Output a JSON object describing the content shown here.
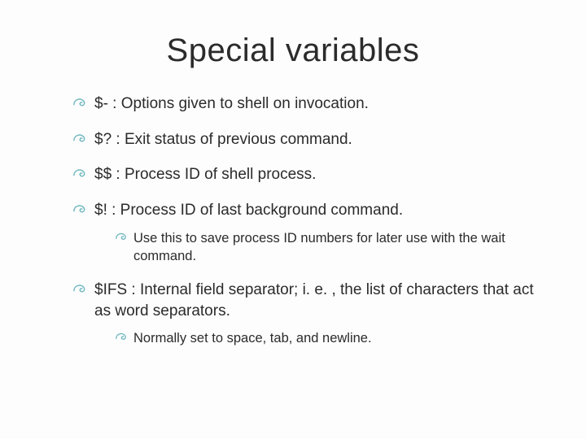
{
  "title": "Special variables",
  "items": [
    {
      "text": "$-  :  Options given to shell on invocation."
    },
    {
      "text": "$?  :  Exit status of previous command."
    },
    {
      "text": "$$  :  Process ID of shell process."
    },
    {
      "text": "$!  : Process ID of last background command.",
      "sub": [
        {
          "text": "Use this to save process ID numbers for later use with the wait command."
        }
      ]
    },
    {
      "text": "$IFS  :  Internal field separator; i. e. , the list of characters that act as word separators.",
      "sub": [
        {
          "text": "Normally set to space, tab, and newline."
        }
      ]
    }
  ]
}
